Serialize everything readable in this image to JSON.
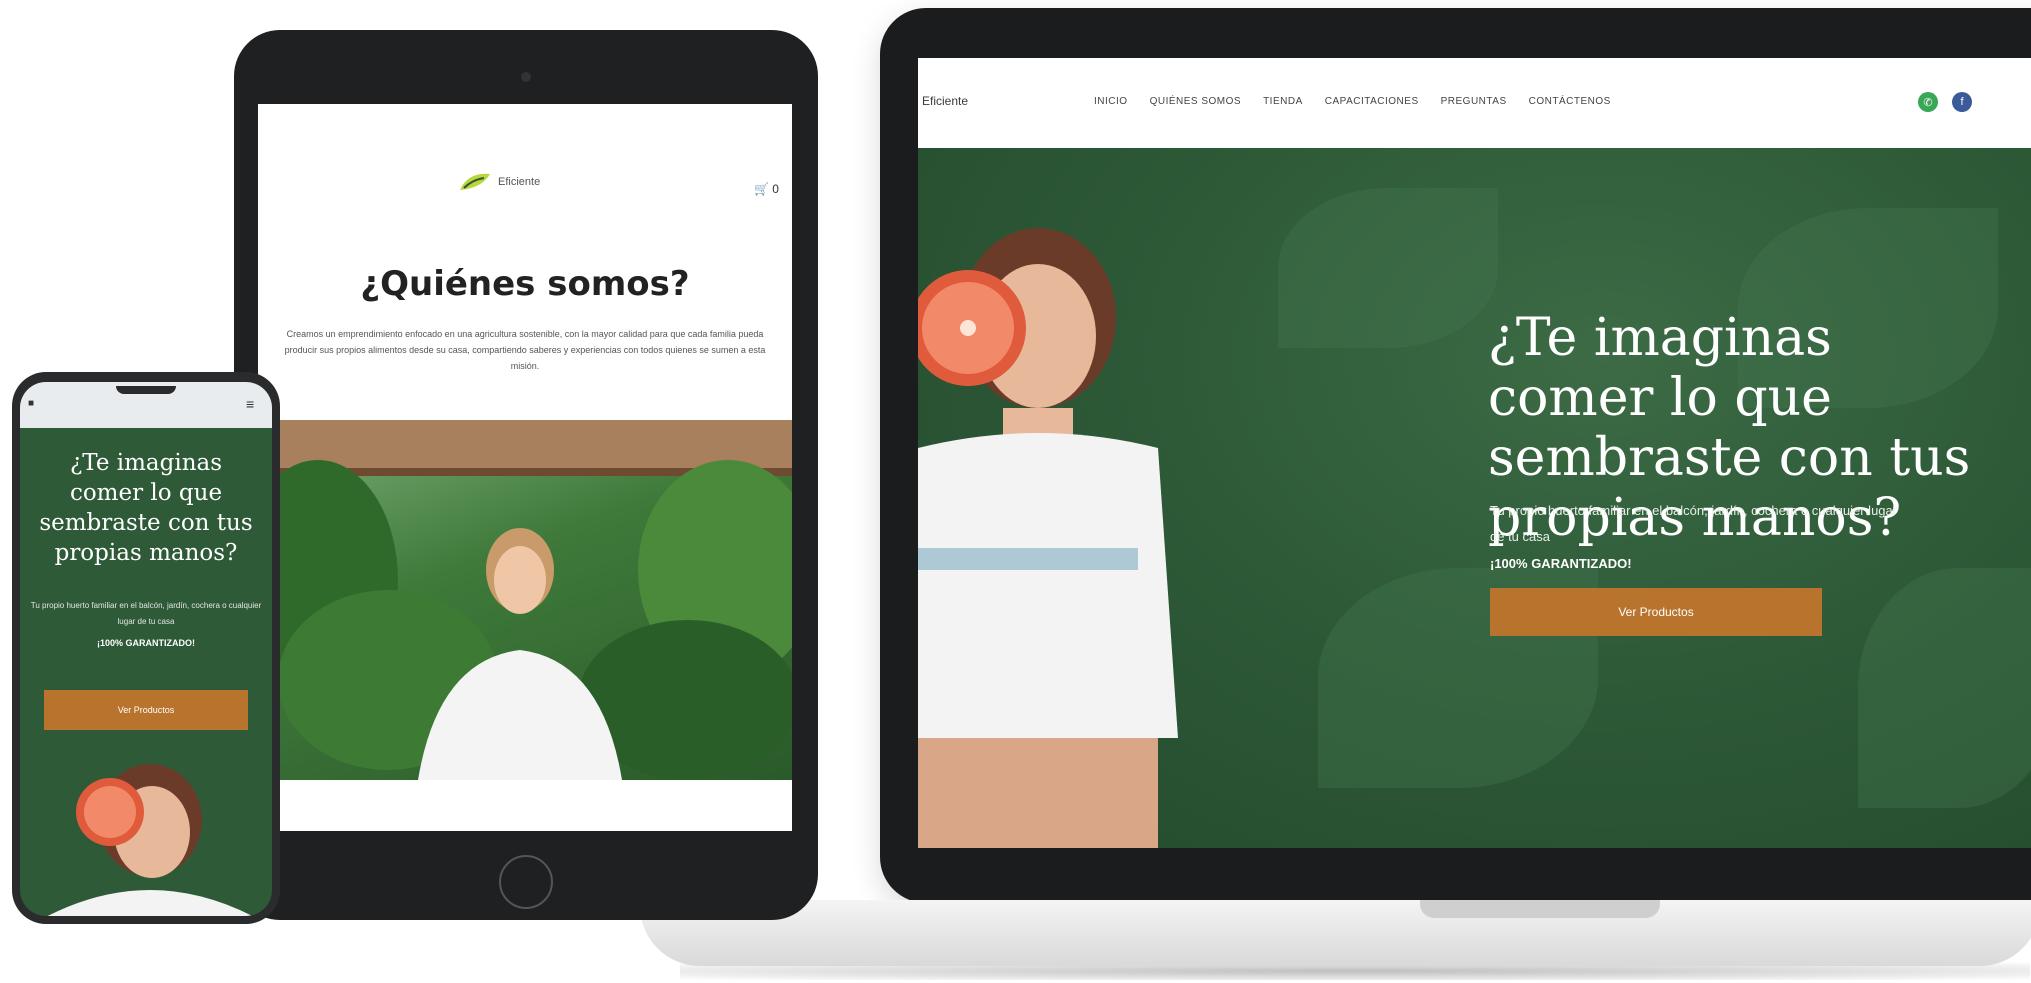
{
  "laptop": {
    "nav": {
      "logo": "Eficiente",
      "links": [
        "INICIO",
        "QUIÉNES SOMOS",
        "TIENDA",
        "CAPACITACIONES",
        "PREGUNTAS",
        "CONTÁCTENOS"
      ]
    },
    "hero": {
      "title": "¿Te imaginas comer lo que sembraste con tus propias manos?",
      "subtitle": "Tu propio huerto familiar en el balcón, jardín, cochera o cualquier lugar de tu casa",
      "guarantee": "¡100% GARANTIZADO!",
      "button": "Ver Productos"
    }
  },
  "tablet": {
    "logo": "Eficiente",
    "cart": "🛒 0",
    "title": "¿Quiénes somos?",
    "text": "Creamos un emprendimiento enfocado en una agricultura sostenible, con la mayor calidad para que cada familia pueda producir sus propios alimentos desde su casa, compartiendo saberes y experiencias con todos quienes se sumen a esta misión."
  },
  "phone": {
    "title": "¿Te imaginas comer lo que sembraste con tus propias manos?",
    "subtitle": "Tu propio huerto familiar en el balcón, jardín, cochera o cualquier lugar de tu casa",
    "guarantee": "¡100% GARANTIZADO!",
    "button": "Ver Productos"
  },
  "colors": {
    "green": "#2e5a38",
    "orange": "#b8732d"
  }
}
